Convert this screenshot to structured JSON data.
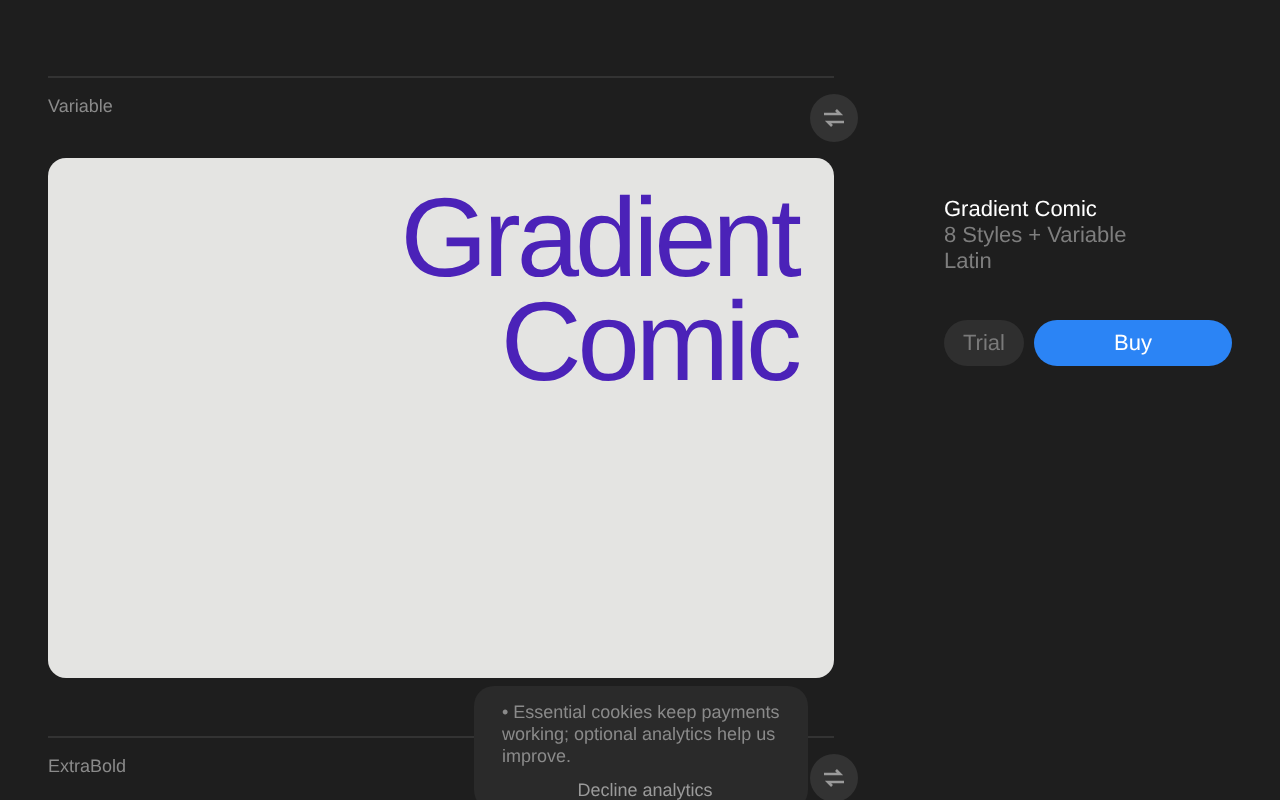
{
  "sections": [
    {
      "label": "Variable",
      "preview": [
        "Gradient",
        "Comic"
      ]
    },
    {
      "label": "ExtraBold"
    }
  ],
  "product": {
    "name": "Gradient Comic",
    "styles": "8 Styles + Variable",
    "script": "Latin",
    "buttons": [
      {
        "label": "Trial",
        "kind": "secondary"
      },
      {
        "label": "Buy",
        "kind": "primary"
      }
    ]
  },
  "cookie_notice": {
    "bullet": "•",
    "text": "Essential cookies keep payments working; optional analytics help us improve.",
    "action": "Decline analytics"
  }
}
